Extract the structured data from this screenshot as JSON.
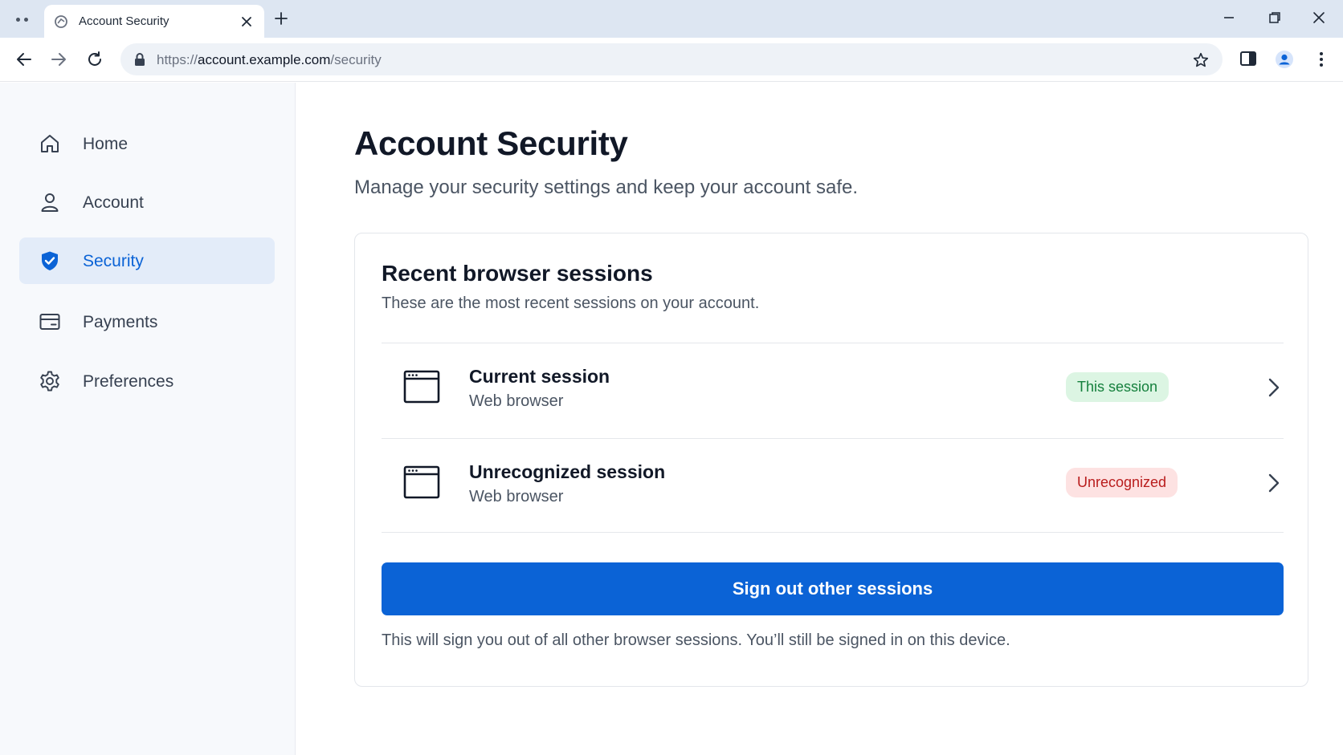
{
  "browser": {
    "tab_title": "Account Security",
    "url_scheme": "https://",
    "url_host": "account.example.com",
    "url_path": "/security"
  },
  "sidebar": {
    "items": [
      {
        "label": "Home",
        "icon": "home-icon",
        "active": false
      },
      {
        "label": "Account",
        "icon": "person-icon",
        "active": false
      },
      {
        "label": "Security",
        "icon": "shield-check-icon",
        "active": true
      },
      {
        "label": "Payments",
        "icon": "card-icon",
        "active": false
      },
      {
        "label": "Preferences",
        "icon": "gear-icon",
        "active": false
      }
    ]
  },
  "main": {
    "title": "Account Security",
    "subtitle": "Manage your security settings and keep your account safe."
  },
  "sessions_card": {
    "title": "Recent browser sessions",
    "description": "These are the most recent sessions on your account.",
    "sessions": [
      {
        "name": "Current session",
        "type": "Web browser",
        "badge": "This session",
        "badge_status": "current"
      },
      {
        "name": "Unrecognized session",
        "type": "Web browser",
        "badge": "Unrecognized",
        "badge_status": "warning"
      }
    ],
    "signout_label": "Sign out other sessions",
    "signout_note": "This will sign you out of all other browser sessions. You’ll still be signed in on this device."
  },
  "colors": {
    "accent": "#0b63d6",
    "active_nav_bg": "#e3ecf9",
    "badge_green_bg": "#dcf5e3",
    "badge_green_text": "#15803d",
    "badge_red_bg": "#fde2e2",
    "badge_red_text": "#b91c1c"
  }
}
